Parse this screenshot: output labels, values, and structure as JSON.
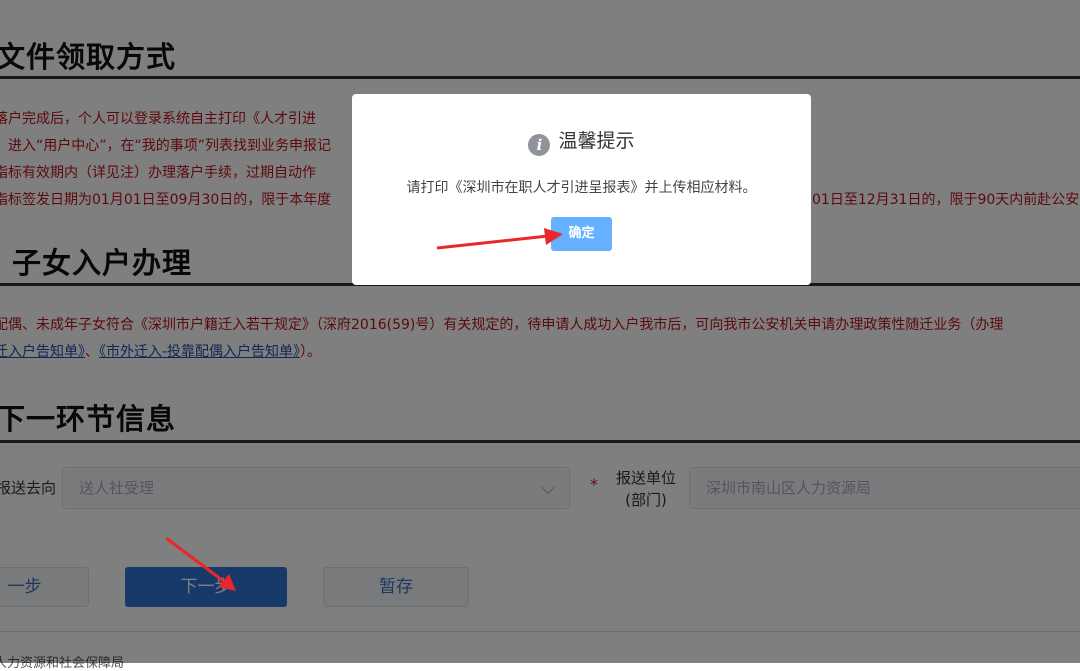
{
  "sections": {
    "file_pickup": {
      "title": "文件领取方式",
      "lines": [
        "落户完成后，个人可以登录系统自主打印《人才引进",
        "：进入“用户中心”，在“我的事项”列表找到业务申报记",
        "指标有效期内（详见注）办理落户手续，过期自动作",
        "指标签发日期为01月01日至09月30日的，限于本年度",
        "01日至12月31日的，限于90天内前赴公安"
      ]
    },
    "children": {
      "title": "子女入户办理",
      "line1": "配偶、未成年子女符合《深圳市户籍迁入若干规定》（深府2016(59)号）有关规定的，待申请人成功入户我市后，可向我市公安机关申请办理政策性随迁业务（办理",
      "link1": "迁入户告知单》",
      "sep": "、",
      "link2": "《市外迁入-投靠配偶入户告知单》",
      "end": "）。"
    },
    "next_step": {
      "title": "下一环节信息"
    }
  },
  "form": {
    "send_to_label": "报送去向",
    "send_to_value": "送人社受理",
    "unit_label_line1": "报送单位",
    "unit_label_line2": "(部门)",
    "unit_value": "深圳市南山区人力资源局",
    "required_mark": "*"
  },
  "buttons": {
    "prev": "一步",
    "next": "下一步",
    "save": "暂存"
  },
  "footer": {
    "text": "人力资源和社会保障局"
  },
  "dialog": {
    "title": "温馨提示",
    "message": "请打印《深圳市在职人才引进呈报表》并上传相应材料。",
    "confirm": "确定",
    "icon": "info-icon"
  },
  "colors": {
    "warning_text": "#b8141b",
    "link": "#1d50a8",
    "primary": "#2f74d6",
    "dialog_button": "#66b1ff",
    "annotation_arrow": "#e8272b"
  }
}
